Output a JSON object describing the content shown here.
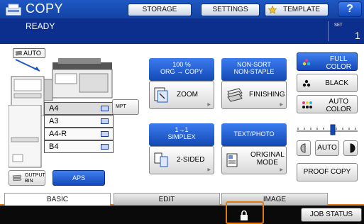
{
  "header": {
    "title": "COPY",
    "buttons": [
      {
        "label": "STORAGE"
      },
      {
        "label": "SETTINGS"
      },
      {
        "label": "TEMPLATE"
      }
    ],
    "help_label": "?"
  },
  "status": {
    "message": "READY",
    "set_label": "SET",
    "set_value": "1"
  },
  "paper": {
    "auto_label": "AUTO",
    "mpt_label": "MPT",
    "trays": [
      {
        "label": "A4",
        "selected": true
      },
      {
        "label": "A3",
        "selected": false
      },
      {
        "label": "A4-R",
        "selected": false
      },
      {
        "label": "B4",
        "selected": false
      }
    ],
    "output_bin_label": "OUTPUT BIN",
    "aps_label": "APS"
  },
  "zoom": {
    "header_line1": "100 %",
    "header_line2": "ORG → COPY",
    "button": "ZOOM"
  },
  "finishing": {
    "header_line1": "NON-SORT",
    "header_line2": "NON-STAPLE",
    "button": "FINISHING"
  },
  "duplex": {
    "header_line1": "1→1",
    "header_line2": "SIMPLEX",
    "button": "2-SIDED"
  },
  "original": {
    "header_line1": "TEXT/PHOTO",
    "button_line1": "ORIGINAL",
    "button_line2": "MODE"
  },
  "color": {
    "full_line1": "FULL",
    "full_line2": "COLOR",
    "black": "BLACK",
    "auto_line1": "AUTO",
    "auto_line2": "COLOR",
    "density_auto": "AUTO",
    "density_level": 0.6
  },
  "proof_copy": "PROOF COPY",
  "tabs": [
    {
      "label": "BASIC",
      "active": true
    },
    {
      "label": "EDIT",
      "active": false
    },
    {
      "label": "IMAGE",
      "active": false
    }
  ],
  "footer": {
    "job_status": "JOB STATUS"
  },
  "colors": {
    "accent": "#1349b4",
    "header": "#1e58c4",
    "status_bg": "#0c2f8d",
    "highlight": "#e07a14"
  }
}
